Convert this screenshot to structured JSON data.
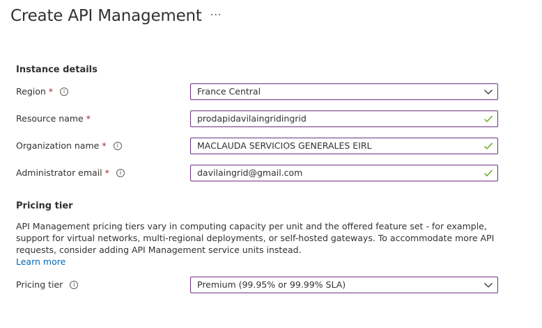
{
  "header": {
    "title": "Create API Management",
    "more_label": "···"
  },
  "instance_details": {
    "heading": "Instance details",
    "region": {
      "label": "Region",
      "required_mark": "*",
      "value": "France Central"
    },
    "resource_name": {
      "label": "Resource name",
      "required_mark": "*",
      "value": "prodapidavilaingridingrid"
    },
    "organization_name": {
      "label": "Organization name",
      "required_mark": "*",
      "value": "MACLAUDA SERVICIOS GENERALES EIRL"
    },
    "administrator_email": {
      "label": "Administrator email",
      "required_mark": "*",
      "value": "davilaingrid@gmail.com"
    }
  },
  "pricing": {
    "heading": "Pricing tier",
    "description": "API Management pricing tiers vary in computing capacity per unit and the offered feature set - for example, support for virtual networks, multi-regional deployments, or self-hosted gateways. To accommodate more API requests, consider adding API Management service units instead.",
    "learn_more": "Learn more",
    "tier": {
      "label": "Pricing tier",
      "value": "Premium (99.95% or 99.99% SLA)"
    }
  },
  "colors": {
    "field_border": "#6e2f84",
    "valid_check": "#57a300",
    "required": "#a4262c",
    "link": "#0067b8"
  }
}
